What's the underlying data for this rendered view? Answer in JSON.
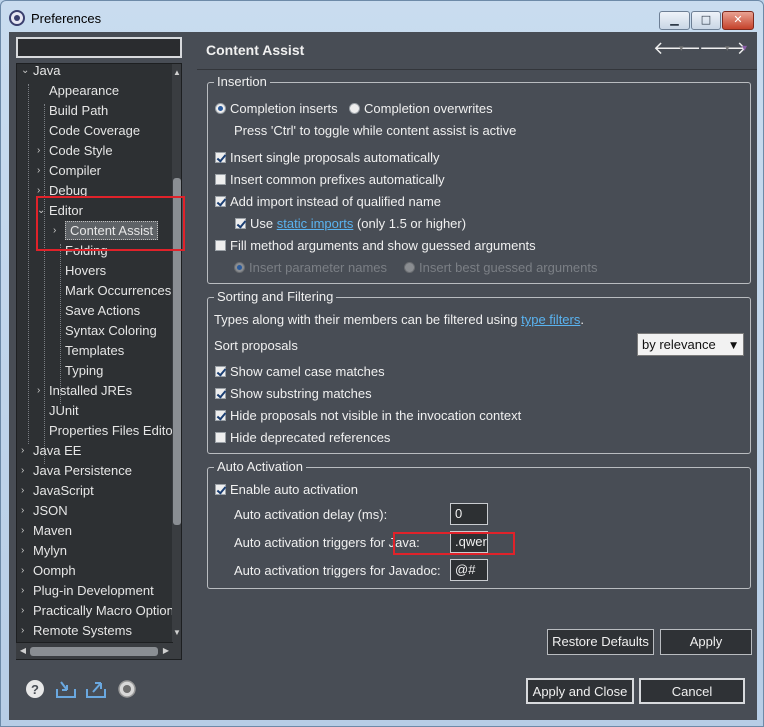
{
  "window": {
    "title": "Preferences"
  },
  "filter": {
    "placeholder": "",
    "value": ""
  },
  "tree": [
    {
      "label": "Java",
      "expander": "⌄"
    },
    {
      "label": "Appearance"
    },
    {
      "label": "Build Path"
    },
    {
      "label": "Code Coverage"
    },
    {
      "label": "Code Style",
      "expander": "›"
    },
    {
      "label": "Compiler",
      "expander": "›"
    },
    {
      "label": "Debug",
      "expander": "›"
    },
    {
      "label": "Editor",
      "expander": "⌄"
    },
    {
      "label": "Content Assist",
      "expander": "›"
    },
    {
      "label": "Folding"
    },
    {
      "label": "Hovers"
    },
    {
      "label": "Mark Occurrences"
    },
    {
      "label": "Save Actions"
    },
    {
      "label": "Syntax Coloring"
    },
    {
      "label": "Templates"
    },
    {
      "label": "Typing"
    },
    {
      "label": "Installed JREs",
      "expander": "›"
    },
    {
      "label": "JUnit"
    },
    {
      "label": "Properties Files Editor"
    },
    {
      "label": "Java EE",
      "expander": "›"
    },
    {
      "label": "Java Persistence",
      "expander": "›"
    },
    {
      "label": "JavaScript",
      "expander": "›"
    },
    {
      "label": "JSON",
      "expander": "›"
    },
    {
      "label": "Maven",
      "expander": "›"
    },
    {
      "label": "Mylyn",
      "expander": "›"
    },
    {
      "label": "Oomph",
      "expander": "›"
    },
    {
      "label": "Plug-in Development",
      "expander": "›"
    },
    {
      "label": "Practically Macro Options",
      "expander": "›"
    },
    {
      "label": "Remote Systems",
      "expander": "›"
    }
  ],
  "page": {
    "title": "Content Assist",
    "nav": {
      "back": "🡐",
      "forward": "🡒",
      "caret": "▾"
    }
  },
  "insertion": {
    "title": "Insertion",
    "completion_inserts": "Completion inserts",
    "completion_overwrites": "Completion overwrites",
    "toggle_hint": "Press 'Ctrl' to toggle while content assist is active",
    "insert_single": "Insert single proposals automatically",
    "insert_common": "Insert common prefixes automatically",
    "add_import": "Add import instead of qualified name",
    "use_label": "Use",
    "static_imports": "static imports",
    "static_suffix": "(only 1.5 or higher)",
    "fill_args": "Fill method arguments and show guessed arguments",
    "insert_param_names": "Insert parameter names",
    "insert_best_guess": "Insert best guessed arguments"
  },
  "sorting": {
    "title": "Sorting and Filtering",
    "filter_text": "Types along with their members can be filtered using",
    "type_filters": "type filters",
    "period": ".",
    "sort_proposals": "Sort proposals",
    "sort_value": "by relevance",
    "camel_case": "Show camel case matches",
    "substring": "Show substring matches",
    "hide_invisible": "Hide proposals not visible in the invocation context",
    "hide_deprecated": "Hide deprecated references"
  },
  "auto_activation": {
    "title": "Auto Activation",
    "enable": "Enable auto activation",
    "delay_label": "Auto activation delay (ms):",
    "delay_value": "0",
    "java_label": "Auto activation triggers for Java:",
    "java_value": ".qwer",
    "javadoc_label": "Auto activation triggers for Javadoc:",
    "javadoc_value": "@#"
  },
  "buttons": {
    "restore_defaults": "Restore Defaults",
    "apply": "Apply",
    "apply_and_close": "Apply and Close",
    "cancel": "Cancel"
  },
  "colors": {
    "background": "#484d55",
    "link": "#5ab3f0",
    "highlight": "#e0222a"
  }
}
